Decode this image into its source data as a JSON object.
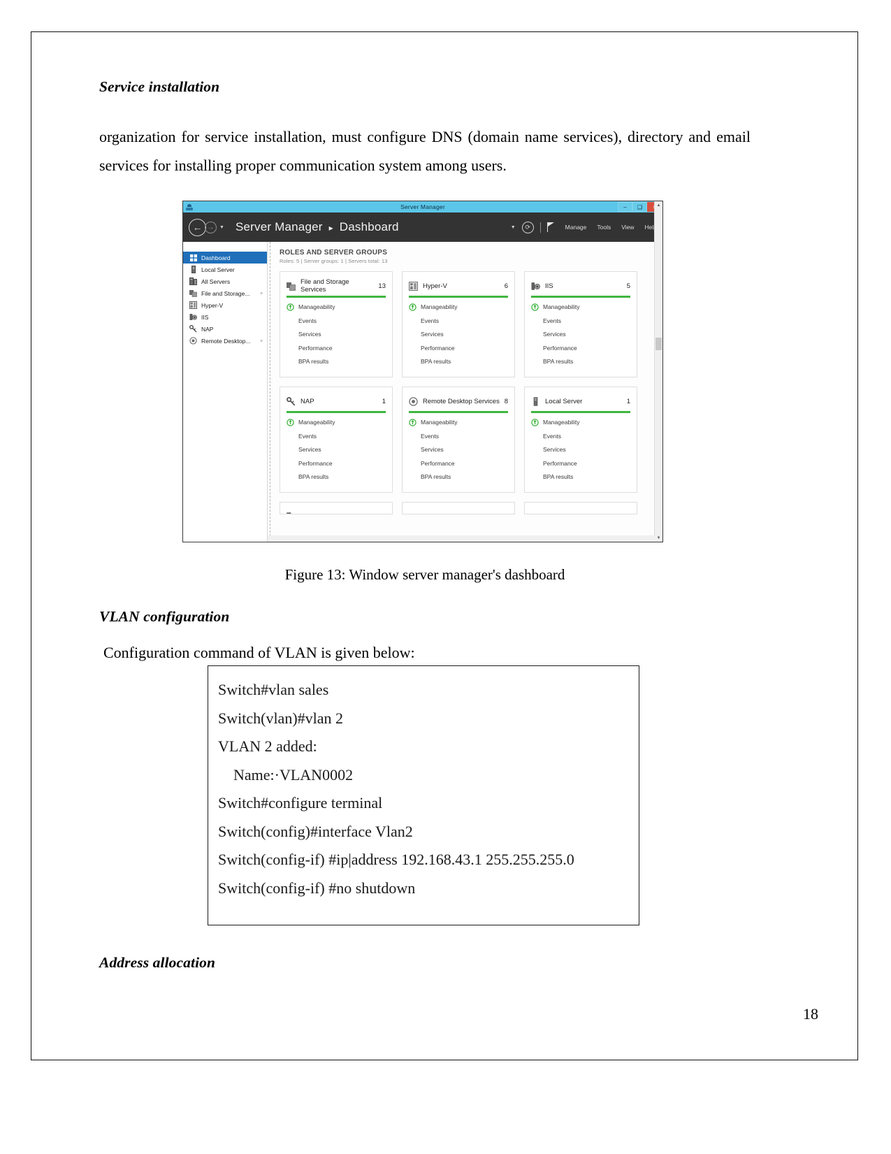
{
  "document": {
    "heading_1": "Service installation",
    "paragraph_1": "organization for service installation, must configure DNS (domain name services), directory and email services for installing proper communication system among users.",
    "figure_caption": "Figure 13: Window server manager's dashboard",
    "heading_2": "VLAN configuration",
    "paragraph_2": "Configuration command of VLAN is given below:",
    "heading_3": "Address allocation",
    "page_number": "18"
  },
  "server_manager": {
    "window_title": "Server Manager",
    "window_buttons": {
      "minimize": "–",
      "maximize": "❑",
      "close": "×"
    },
    "breadcrumb": {
      "app": "Server Manager",
      "separator": "▸",
      "page": "Dashboard"
    },
    "toolbar_menus": [
      "Manage",
      "Tools",
      "View",
      "Help"
    ],
    "sidebar": {
      "items": [
        {
          "label": "Dashboard",
          "icon": "grid-icon",
          "selected": true,
          "arrow": ""
        },
        {
          "label": "Local Server",
          "icon": "server-icon",
          "selected": false,
          "arrow": ""
        },
        {
          "label": "All Servers",
          "icon": "servers-icon",
          "selected": false,
          "arrow": ""
        },
        {
          "label": "File and Storage...",
          "icon": "storage-icon",
          "selected": false,
          "arrow": "▹"
        },
        {
          "label": "Hyper-V",
          "icon": "hyperv-icon",
          "selected": false,
          "arrow": ""
        },
        {
          "label": "IIS",
          "icon": "iis-icon",
          "selected": false,
          "arrow": ""
        },
        {
          "label": "NAP",
          "icon": "nap-icon",
          "selected": false,
          "arrow": ""
        },
        {
          "label": "Remote Desktop...",
          "icon": "remote-desktop-icon",
          "selected": false,
          "arrow": "▹"
        }
      ]
    },
    "main": {
      "section_title": "ROLES AND SERVER GROUPS",
      "section_subtitle": "Roles: 5  |  Server groups: 1  |  Servers total: 13",
      "row_labels": [
        "Manageability",
        "Events",
        "Services",
        "Performance",
        "BPA results"
      ],
      "tiles": [
        {
          "name": "File and Storage Services",
          "count": "13",
          "icon": "storage-icon"
        },
        {
          "name": "Hyper-V",
          "count": "6",
          "icon": "hyperv-icon"
        },
        {
          "name": "IIS",
          "count": "5",
          "icon": "iis-icon"
        },
        {
          "name": "NAP",
          "count": "1",
          "icon": "nap-icon"
        },
        {
          "name": "Remote Desktop Services",
          "count": "8",
          "icon": "remote-desktop-icon"
        },
        {
          "name": "Local Server",
          "count": "1",
          "icon": "server-icon"
        }
      ],
      "accent_color": "#3fb63f",
      "selected_color": "#1f6fba"
    }
  },
  "vlan_commands": [
    {
      "text": "Switch#vlan sales",
      "indent": false
    },
    {
      "text": "Switch(vlan)#vlan 2",
      "indent": false
    },
    {
      "text": "VLAN 2 added:",
      "indent": false
    },
    {
      "text": "Name:·VLAN0002",
      "indent": true
    },
    {
      "text": "Switch#configure terminal",
      "indent": false
    },
    {
      "text": "Switch(config)#interface Vlan2",
      "indent": false
    },
    {
      "text": "Switch(config-if) #ip|address 192.168.43.1 255.255.255.0",
      "indent": false
    },
    {
      "text": "Switch(config-if) #no shutdown",
      "indent": false
    }
  ]
}
